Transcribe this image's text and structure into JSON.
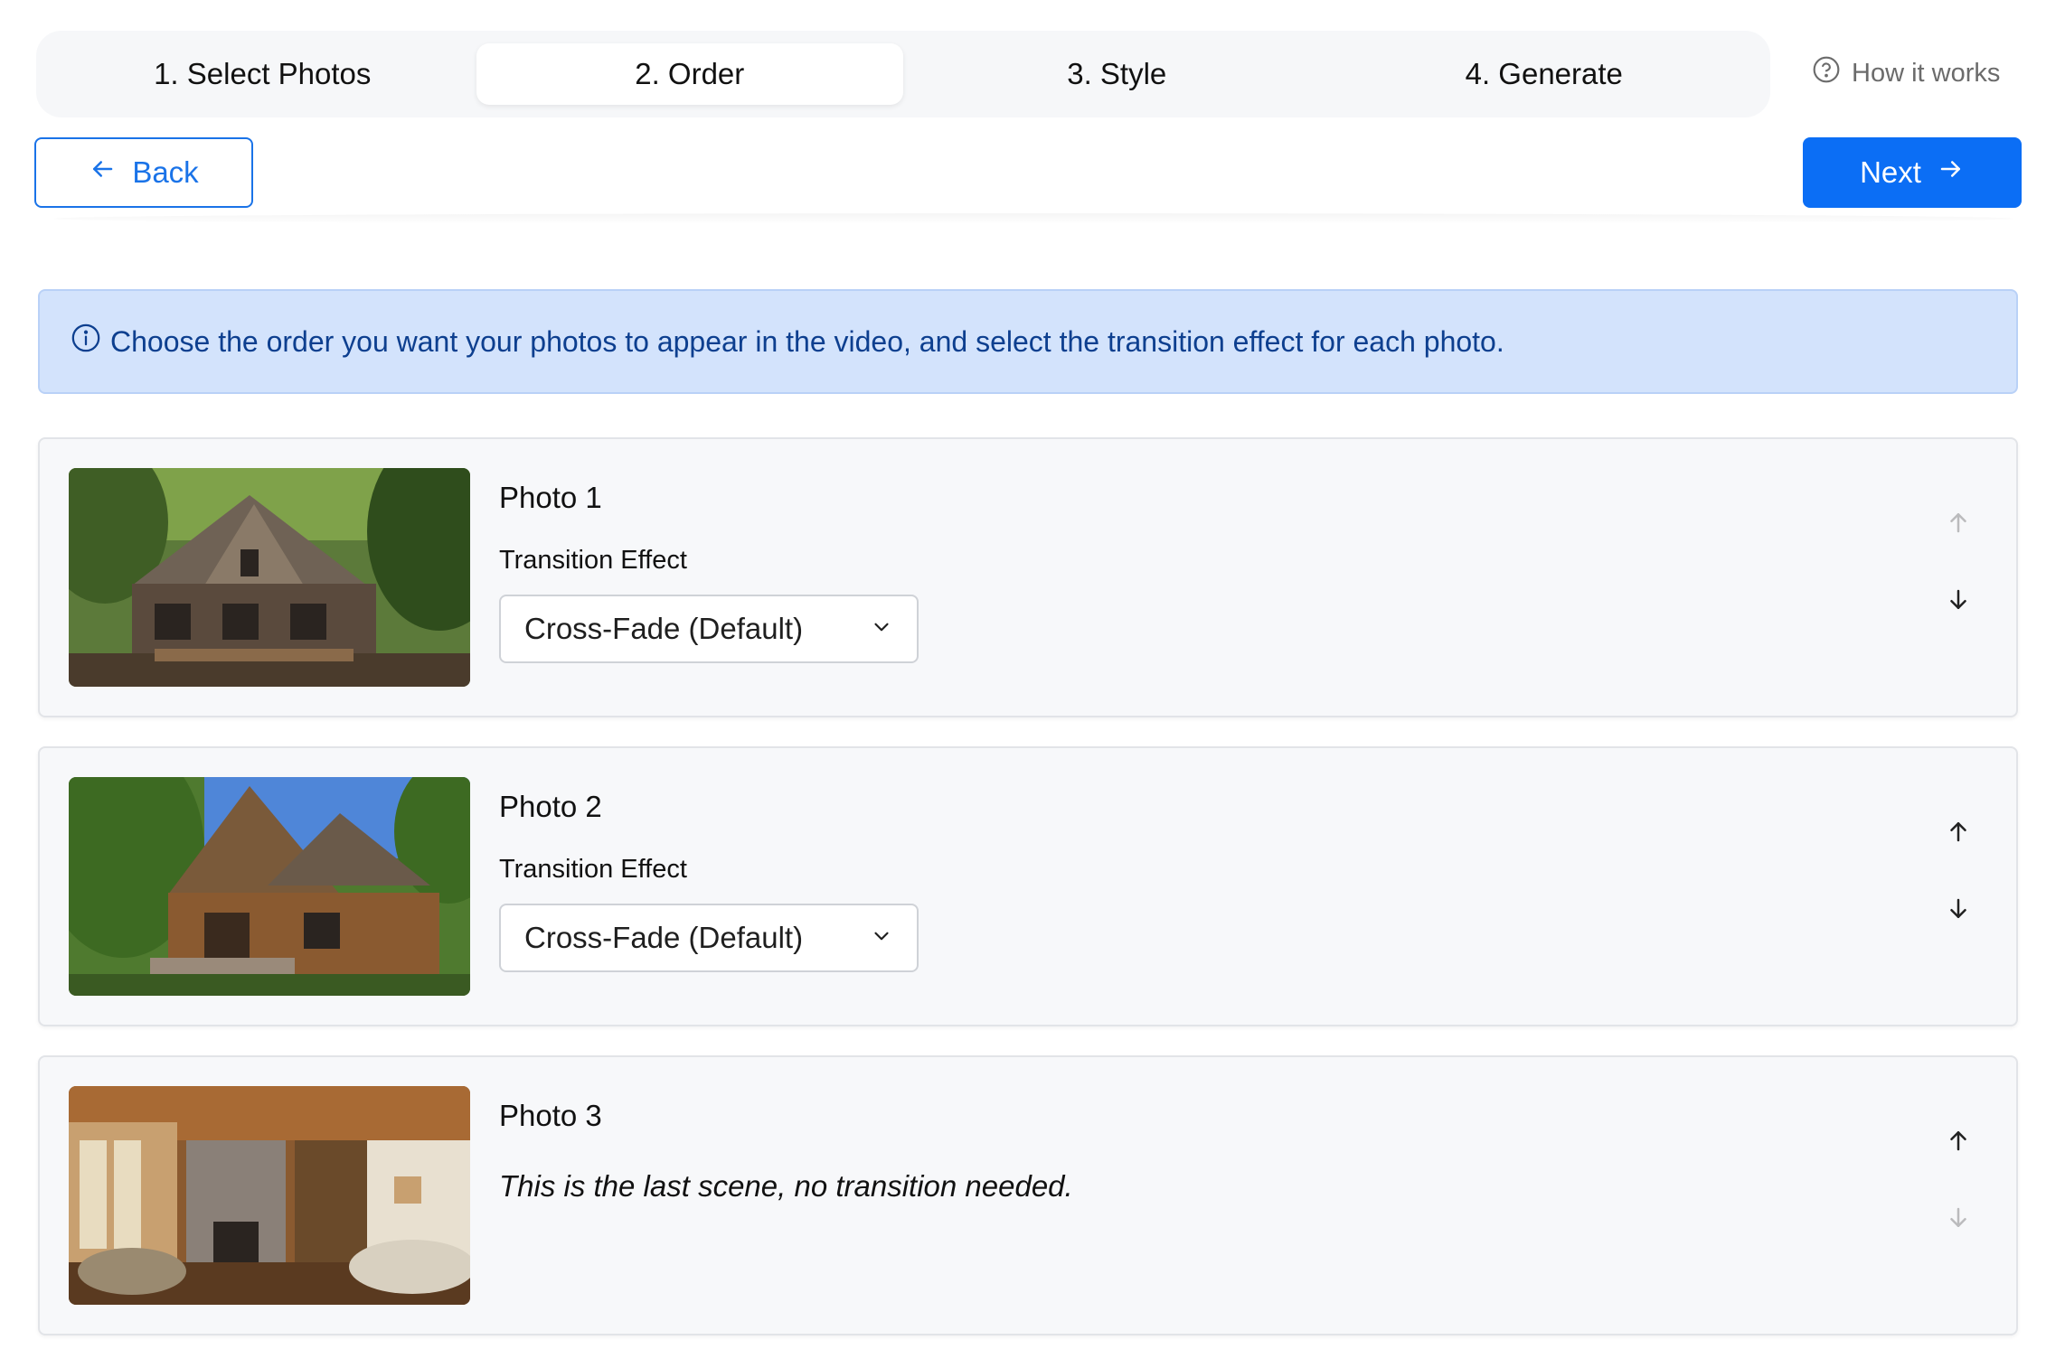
{
  "stepper": {
    "steps": [
      {
        "label": "1. Select Photos",
        "active": false
      },
      {
        "label": "2. Order",
        "active": true
      },
      {
        "label": "3. Style",
        "active": false
      },
      {
        "label": "4. Generate",
        "active": false
      }
    ],
    "help_link": "How it works"
  },
  "nav": {
    "back_label": "Back",
    "next_label": "Next"
  },
  "info": {
    "message": "Choose the order you want your photos to appear in the video, and select the transition effect for each photo."
  },
  "photos": [
    {
      "title": "Photo 1",
      "transition_label": "Transition Effect",
      "transition_value": "Cross-Fade (Default)",
      "up_disabled": true,
      "down_disabled": false
    },
    {
      "title": "Photo 2",
      "transition_label": "Transition Effect",
      "transition_value": "Cross-Fade (Default)",
      "up_disabled": false,
      "down_disabled": false
    },
    {
      "title": "Photo 3",
      "last_note": "This is the last scene, no transition needed.",
      "up_disabled": false,
      "down_disabled": true
    }
  ],
  "colors": {
    "primary": "#0b6ef5",
    "info_bg": "#d3e3fc",
    "info_text": "#0d3f8f",
    "card_bg": "#f7f8fa"
  },
  "icons": {
    "help": "question-circle-icon",
    "back": "arrow-left-icon",
    "next": "arrow-right-icon",
    "info": "info-circle-icon",
    "select": "chevron-down-icon",
    "move_up": "arrow-up-icon",
    "move_down": "arrow-down-icon"
  }
}
